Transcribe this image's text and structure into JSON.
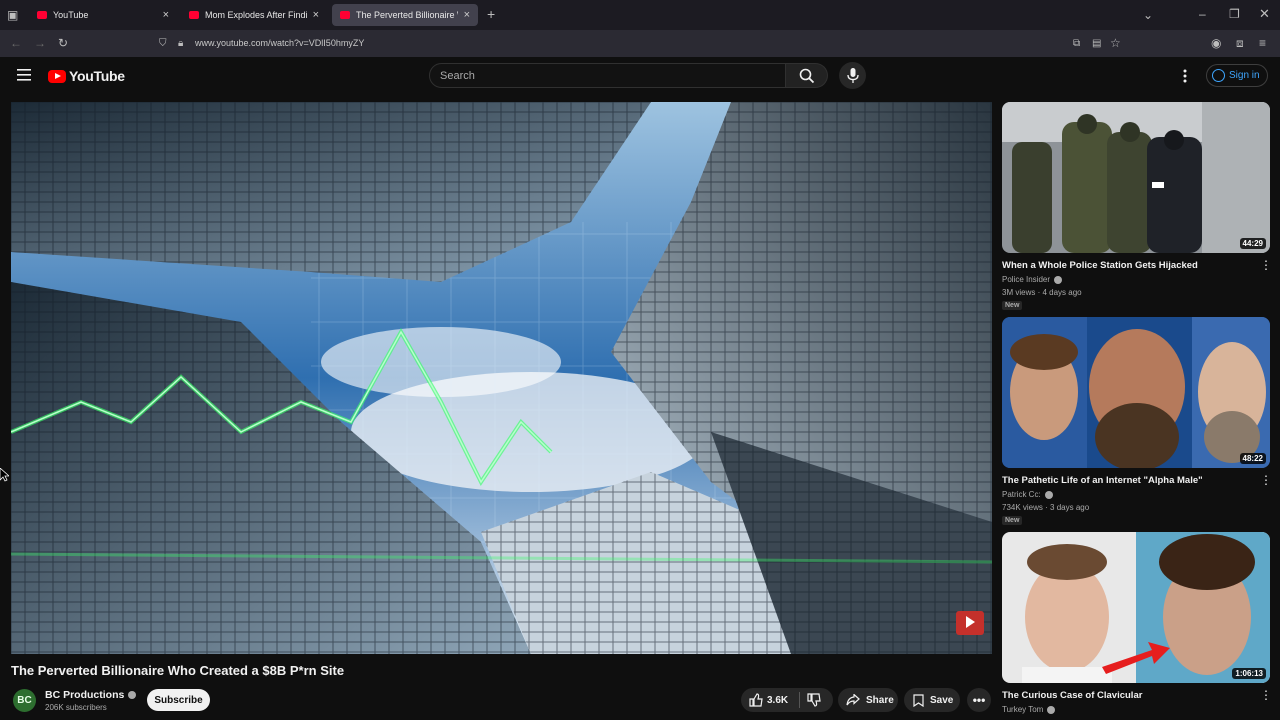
{
  "browser": {
    "tabs": [
      {
        "title": "YouTube",
        "active": false
      },
      {
        "title": "Mom Explodes After Finding O",
        "active": false
      },
      {
        "title": "The Perverted Billionaire W",
        "active": true
      }
    ],
    "url": "www.youtube.com/watch?v=VDlI50hmyZY"
  },
  "youtube": {
    "logo_text": "YouTube",
    "search_placeholder": "Search",
    "sign_in_label": "Sign in"
  },
  "video": {
    "title": "The Perverted Billionaire Who Created a $8B P*rn Site",
    "channel": {
      "name": "BC Productions",
      "subscribers": "206K subscribers",
      "avatar_text": "BC"
    },
    "subscribe_label": "Subscribe",
    "likes": "3.6K",
    "share_label": "Share",
    "save_label": "Save"
  },
  "recommendations": [
    {
      "title": "When a Whole Police Station Gets Hijacked",
      "channel": "Police Insider",
      "meta": "3M views · 4 days ago",
      "badge": "New",
      "duration": "44:29",
      "verified": true
    },
    {
      "title": "The Pathetic Life of an Internet \"Alpha Male\"",
      "channel": "Patrick Cc:",
      "meta": "734K views · 3 days ago",
      "badge": "New",
      "duration": "48:22",
      "verified": true
    },
    {
      "title": "The Curious Case of Clavicular",
      "channel": "Turkey Tom",
      "meta": "",
      "badge": "",
      "duration": "1:06:13",
      "verified": true
    }
  ],
  "colors": {
    "accent_red": "#ff0000",
    "link_blue": "#3ea6ff",
    "background": "#0f0f0f"
  }
}
